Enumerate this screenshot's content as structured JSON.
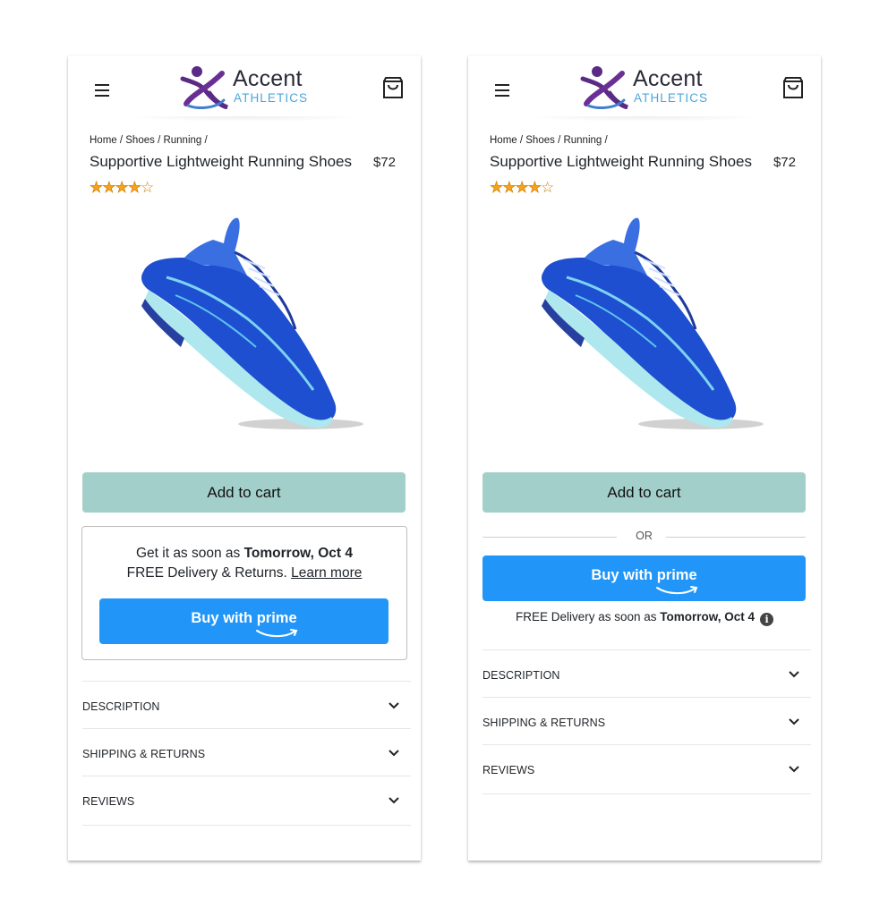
{
  "brand": {
    "name": "Accent",
    "subtitle": "ATHLETICS",
    "colors": {
      "purple": "#5b2a86",
      "blue": "#4aa6d9"
    }
  },
  "icons": {
    "menu": "hamburger-menu-icon",
    "cart": "shopping-bag-icon",
    "chevron": "chevron-down-icon",
    "info": "info-icon"
  },
  "product": {
    "breadcrumb": "Home / Shoes / Running /",
    "title": "Supportive Lightweight Running Shoes",
    "price": "$72",
    "rating": 4,
    "rating_max": 5
  },
  "variant_a": {
    "add_to_cart": "Add to cart",
    "delivery_prefix": "Get it as soon as ",
    "delivery_date": "Tomorrow, Oct 4",
    "free_delivery": "FREE Delivery & Returns. ",
    "learn_more": "Learn more",
    "prime_button_prefix": "Buy with ",
    "prime_button_brand": "prime",
    "accordion": [
      "DESCRIPTION",
      "SHIPPING & RETURNS",
      "REVIEWS"
    ]
  },
  "variant_b": {
    "add_to_cart": "Add to cart",
    "or_label": "OR",
    "prime_button_prefix": "Buy with ",
    "prime_button_brand": "prime",
    "free_note_prefix": "FREE Delivery as soon as ",
    "free_note_date": "Tomorrow, Oct 4",
    "info_glyph": "i",
    "accordion": [
      "DESCRIPTION",
      "SHIPPING & RETURNS",
      "REVIEWS"
    ]
  },
  "colors": {
    "add_to_cart_bg": "#a3cfca",
    "prime_button_bg": "#2196f8",
    "star": "#f6a21c"
  }
}
